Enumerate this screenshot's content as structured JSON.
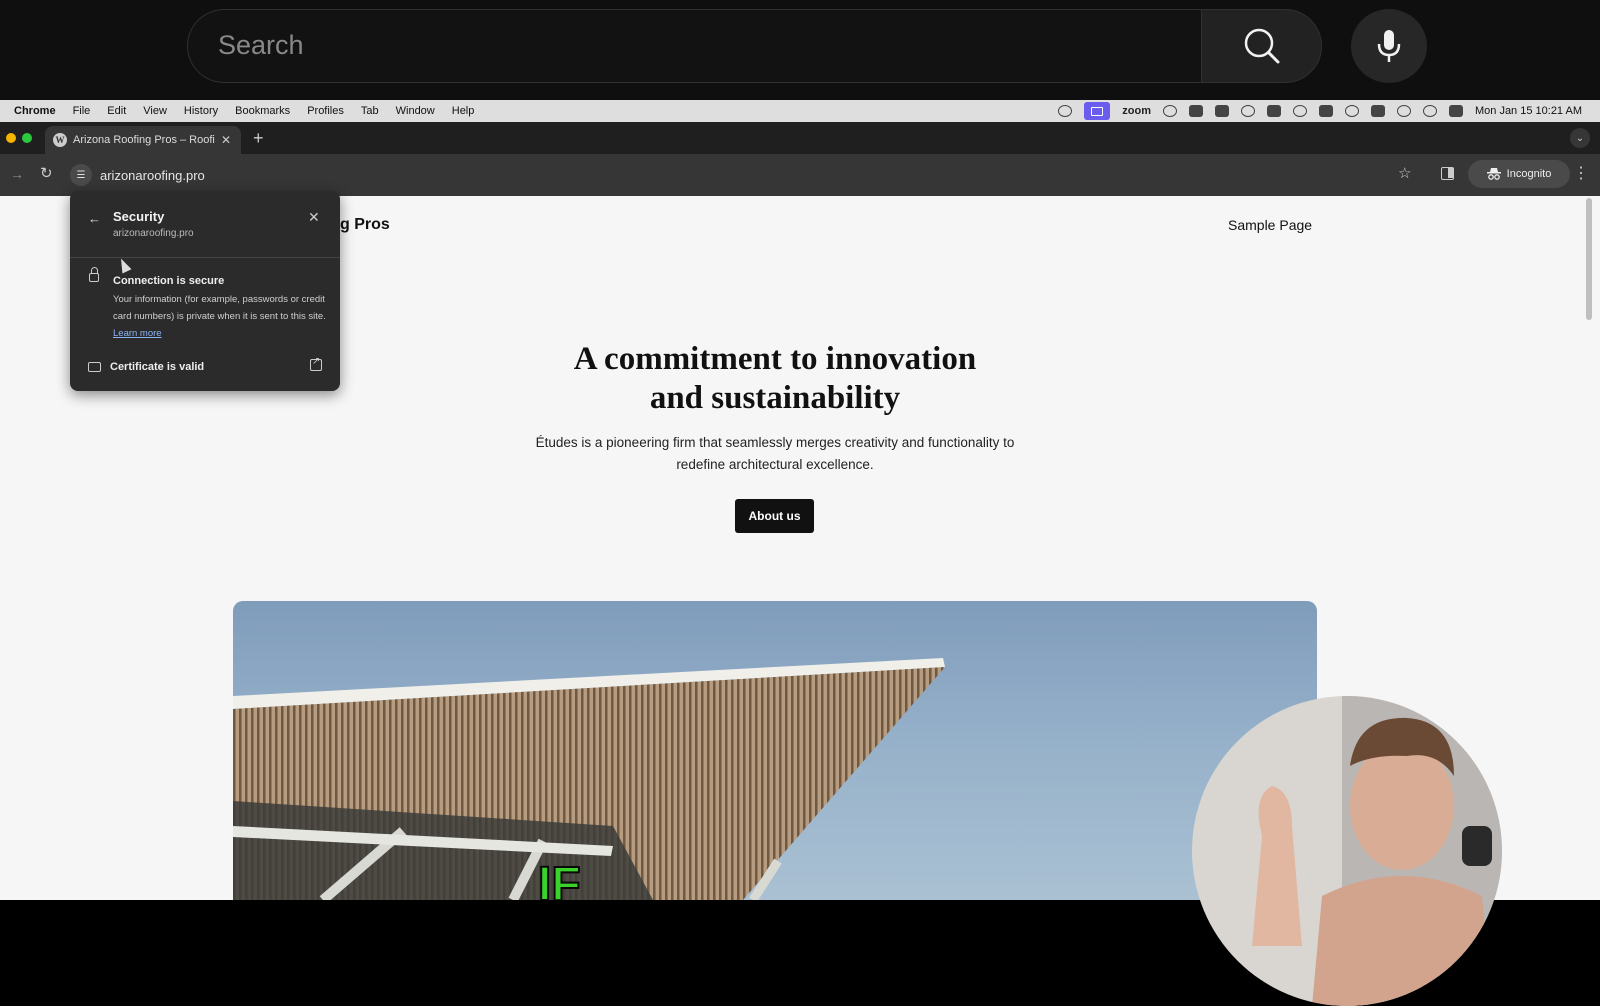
{
  "yt": {
    "search_placeholder": "Search"
  },
  "mac_menubar": {
    "items": [
      "Chrome",
      "File",
      "Edit",
      "View",
      "History",
      "Bookmarks",
      "Profiles",
      "Tab",
      "Window",
      "Help"
    ],
    "zoom_label": "zoom",
    "clock": "Mon Jan 15  10:21 AM",
    "active_icon_color": "#6b5cf0"
  },
  "browser": {
    "tab_title": "Arizona Roofing Pros – Roofi",
    "new_tab_glyph": "+",
    "url": "arizonaroofing.pro",
    "incognito_label": "Incognito"
  },
  "security_popup": {
    "title": "Security",
    "domain": "arizonaroofing.pro",
    "connection_title": "Connection is secure",
    "connection_desc": "Your information (for example, passwords or credit card numbers) is private when it is sent to this site.",
    "learn_more": "Learn more",
    "certificate_label": "Certificate is valid"
  },
  "site": {
    "title_partial": "g Pros",
    "nav_link": "Sample Page",
    "headline_line1": "A commitment to innovation",
    "headline_line2": "and sustainability",
    "lead_text": "Études is a pioneering firm that seamlessly merges creativity and functionality to redefine architectural excellence.",
    "cta_label": "About us"
  },
  "caption_fragment": "IF",
  "colors": {
    "yt_bg": "#0f0f0f",
    "page_bg": "#f6f6f6",
    "cta_bg": "#111111",
    "link": "#8ab4f8",
    "caption_green": "#3cd22c"
  }
}
